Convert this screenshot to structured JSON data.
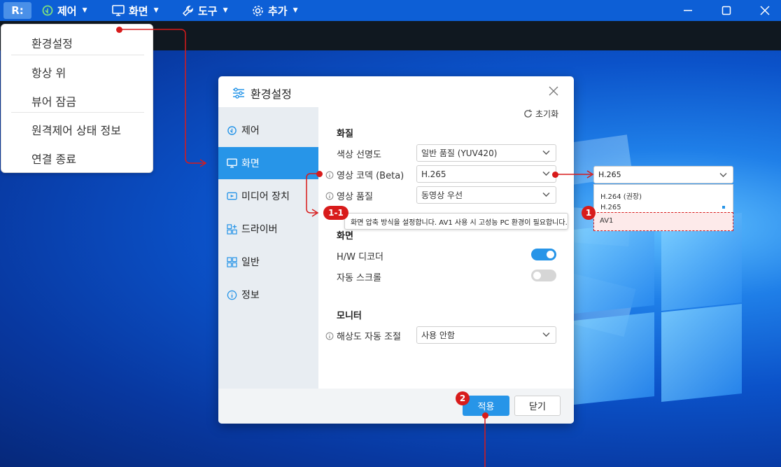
{
  "titlebar": {
    "logo": "R:",
    "menus": [
      {
        "label": "제어",
        "icon": "remote-control-icon"
      },
      {
        "label": "화면",
        "icon": "monitor-icon"
      },
      {
        "label": "도구",
        "icon": "wrench-icon"
      },
      {
        "label": "추가",
        "icon": "gear-icon"
      }
    ],
    "window_controls": [
      "minimize-icon",
      "maximize-icon",
      "close-icon"
    ]
  },
  "app_menu": {
    "items": [
      "환경설정",
      "항상 위",
      "뷰어 잠금",
      "원격제어 상태 정보",
      "연결 종료"
    ]
  },
  "dialog": {
    "title": "환경설정",
    "sidebar": [
      {
        "label": "제어",
        "icon": "remote-control-icon"
      },
      {
        "label": "화면",
        "icon": "monitor-icon",
        "active": true
      },
      {
        "label": "미디어 장치",
        "icon": "media-device-icon"
      },
      {
        "label": "드라이버",
        "icon": "driver-icon"
      },
      {
        "label": "일반",
        "icon": "grid-icon"
      },
      {
        "label": "정보",
        "icon": "info-icon"
      }
    ],
    "reset_label": "초기화",
    "sections": {
      "quality": {
        "heading": "화질",
        "color_clarity": {
          "label": "색상 선명도",
          "value": "일반 품질 (YUV420)"
        },
        "video_codec": {
          "label": "영상 코덱 (Beta)",
          "value": "H.265"
        },
        "video_quality": {
          "label": "영상 품질",
          "value": "동영상 우선"
        }
      },
      "screen": {
        "heading": "화면",
        "hw_decoder": {
          "label": "H/W 디코더",
          "on": true
        },
        "auto_scroll": {
          "label": "자동 스크롤",
          "on": false
        }
      },
      "monitor": {
        "heading": "모니터",
        "auto_resolution": {
          "label": "해상도 자동 조절",
          "value": "사용 안함"
        }
      }
    },
    "tooltip": "화면 압축 방식을 설정합니다. AV1 사용 시 고성능 PC 환경이 필요합니다.",
    "apply_label": "적용",
    "close_label": "닫기"
  },
  "codec_dropdown": {
    "selected": "H.265",
    "options": [
      "H.264 (권장)",
      "H.265",
      "AV1"
    ],
    "highlighted": "AV1"
  },
  "callouts": {
    "one": "1",
    "one_one": "1-1",
    "two": "2"
  },
  "colors": {
    "accent": "#2795e8",
    "callout": "#d81b1b",
    "titlebar": "#0d5fd6"
  }
}
